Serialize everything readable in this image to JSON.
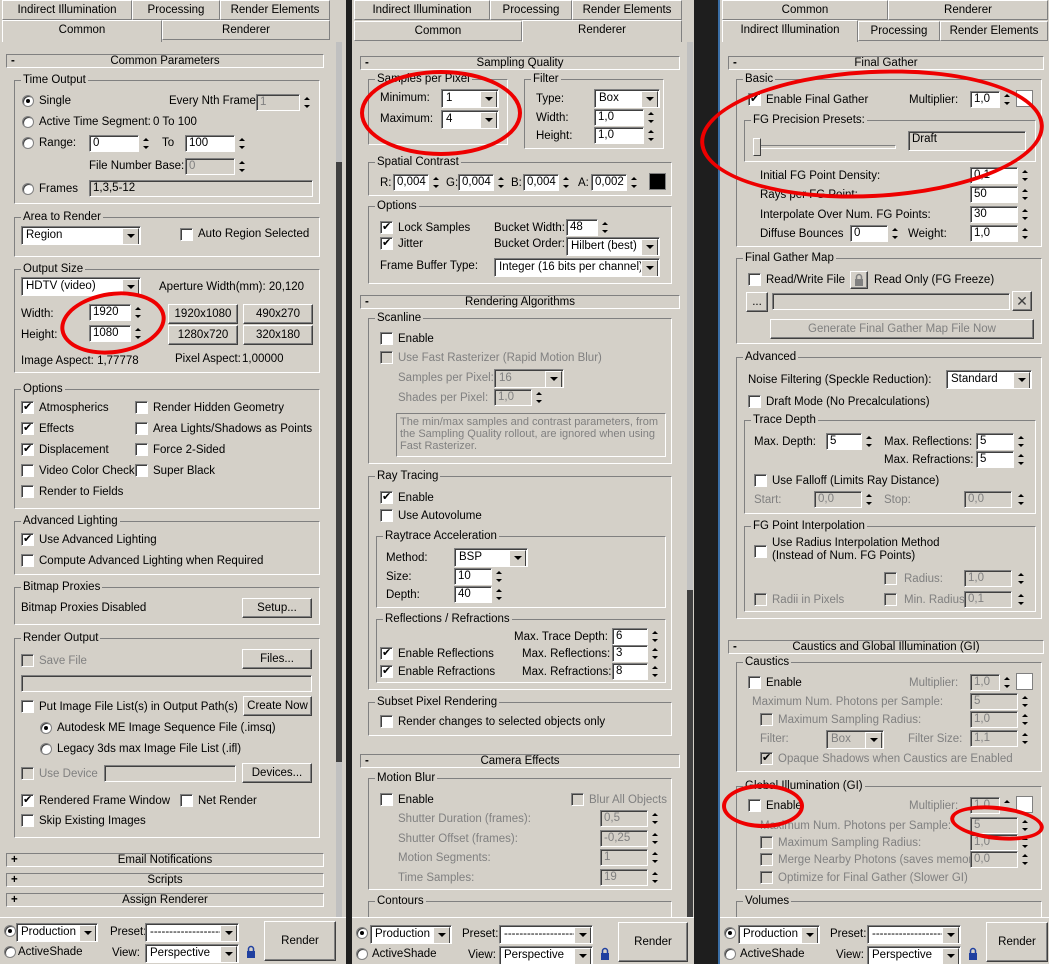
{
  "tabs": {
    "indirect": "Indirect Illumination",
    "processing": "Processing",
    "render_elements": "Render Elements",
    "common": "Common",
    "renderer": "Renderer"
  },
  "common_params": {
    "header": "Common Parameters",
    "time_output": {
      "title": "Time Output",
      "single": "Single",
      "every_nth": "Every Nth Frame:",
      "every_nth_val": "1",
      "active_segment": "Active Time Segment:",
      "segment_range": "0 To 100",
      "range": "Range:",
      "range_from": "0",
      "to": "To",
      "range_to": "100",
      "file_number_base": "File Number Base:",
      "file_number_base_val": "0",
      "frames": "Frames",
      "frames_val": "1,3,5-12"
    },
    "area": {
      "title": "Area to Render",
      "value": "Region",
      "auto_region": "Auto Region Selected"
    },
    "output_size": {
      "title": "Output Size",
      "preset": "HDTV (video)",
      "aperture": "Aperture Width(mm): 20,120",
      "width_label": "Width:",
      "width": "1920",
      "height_label": "Height:",
      "height": "1080",
      "p1": "1920x1080",
      "p2": "490x270",
      "p3": "1280x720",
      "p4": "320x180",
      "image_aspect": "Image Aspect: 1,77778",
      "pixel_aspect": "Pixel Aspect:",
      "pixel_aspect_val": "1,00000"
    },
    "options": {
      "title": "Options",
      "atmospherics": "Atmospherics",
      "render_hidden": "Render Hidden Geometry",
      "effects": "Effects",
      "area_lights": "Area Lights/Shadows as Points",
      "displacement": "Displacement",
      "force2": "Force 2-Sided",
      "video_color": "Video Color Check",
      "super_black": "Super Black",
      "render_fields": "Render to Fields"
    },
    "adv_lighting": {
      "title": "Advanced Lighting",
      "use": "Use Advanced Lighting",
      "compute": "Compute Advanced Lighting when Required"
    },
    "bitmap": {
      "title": "Bitmap Proxies",
      "status": "Bitmap Proxies Disabled",
      "setup": "Setup..."
    },
    "render_output": {
      "title": "Render Output",
      "save_file": "Save File",
      "files": "Files...",
      "put_list": "Put Image File List(s) in Output Path(s)",
      "create_now": "Create Now",
      "autodesk": "Autodesk ME Image Sequence File (.imsq)",
      "legacy": "Legacy 3ds max Image File List (.ifl)",
      "use_device": "Use Device",
      "devices": "Devices...",
      "rfw": "Rendered Frame Window",
      "net_render": "Net Render",
      "skip": "Skip Existing Images"
    },
    "email": "Email Notifications",
    "scripts": "Scripts",
    "assign": "Assign Renderer"
  },
  "sampling": {
    "header": "Sampling Quality",
    "spp_title": "Samples per Pixel",
    "min_label": "Minimum:",
    "min": "1",
    "max_label": "Maximum:",
    "max": "4",
    "filter_title": "Filter",
    "type_label": "Type:",
    "type": "Box",
    "width_label": "Width:",
    "width": "1,0",
    "height_label": "Height:",
    "height": "1,0",
    "spatial_title": "Spatial Contrast",
    "r": "R:",
    "rv": "0,004",
    "g": "G:",
    "gv": "0,004",
    "b": "B:",
    "bv": "0,004",
    "a": "A:",
    "av": "0,002",
    "options_title": "Options",
    "lock": "Lock Samples",
    "bucket_width": "Bucket Width:",
    "bucket_width_val": "48",
    "jitter": "Jitter",
    "bucket_order": "Bucket Order:",
    "bucket_order_val": "Hilbert (best)",
    "fbt": "Frame Buffer Type:",
    "fbt_val": "Integer (16 bits per channel)"
  },
  "algorithms": {
    "header": "Rendering Algorithms",
    "scanline": "Scanline",
    "enable": "Enable",
    "fast_raster": "Use Fast Rasterizer (Rapid Motion Blur)",
    "spp": "Samples per Pixel:",
    "spp_val": "16",
    "sps": "Shades per Pixel:",
    "sps_val": "1,0",
    "note": "The min/max samples and contrast parameters, from the Sampling Quality rollout, are ignored when using Fast Rasterizer.",
    "ray": "Ray Tracing",
    "ray_enable": "Enable",
    "autovolume": "Use Autovolume",
    "accel": "Raytrace Acceleration",
    "method_label": "Method:",
    "method": "BSP",
    "size_label": "Size:",
    "size": "10",
    "depth_label": "Depth:",
    "depth": "40",
    "refl": "Reflections / Refractions",
    "max_trace": "Max. Trace Depth:",
    "max_trace_val": "6",
    "en_refl": "Enable Reflections",
    "max_refl": "Max. Reflections:",
    "max_refl_val": "3",
    "en_refr": "Enable Refractions",
    "max_refr": "Max. Refractions:",
    "max_refr_val": "8",
    "subset": "Subset Pixel Rendering",
    "subset_opt": "Render changes to selected objects only"
  },
  "camera": {
    "header": "Camera Effects",
    "mb": "Motion Blur",
    "enable": "Enable",
    "blur_all": "Blur All Objects",
    "shutter_dur": "Shutter Duration (frames):",
    "shutter_dur_val": "0,5",
    "shutter_off": "Shutter Offset (frames):",
    "shutter_off_val": "-0,25",
    "segments": "Motion Segments:",
    "segments_val": "1",
    "time_samples": "Time Samples:",
    "time_samples_val": "19",
    "contours": "Contours"
  },
  "fg": {
    "header": "Final Gather",
    "basic": "Basic",
    "enable": "Enable Final Gather",
    "multiplier": "Multiplier:",
    "mult_val": "1,0",
    "presets": "FG Precision Presets:",
    "preset_val": "Draft",
    "density": "Initial FG Point Density:",
    "density_val": "0,1",
    "rays": "Rays per FG Point:",
    "rays_val": "50",
    "interp": "Interpolate Over Num. FG Points:",
    "interp_val": "30",
    "diffuse": "Diffuse Bounces",
    "diffuse_val": "0",
    "weight": "Weight:",
    "weight_val": "1,0",
    "map": "Final Gather Map",
    "rw": "Read/Write File",
    "ro": "Read Only (FG Freeze)",
    "browse": "...",
    "generate": "Generate Final Gather Map File Now",
    "adv": "Advanced",
    "noise": "Noise Filtering (Speckle Reduction):",
    "noise_val": "Standard",
    "draft": "Draft Mode (No Precalculations)",
    "trace": "Trace Depth",
    "max_depth": "Max. Depth:",
    "max_depth_val": "5",
    "max_refl": "Max. Reflections:",
    "max_refl_val": "5",
    "max_refr": "Max. Refractions:",
    "max_refr_val": "5",
    "falloff": "Use Falloff (Limits Ray Distance)",
    "start": "Start:",
    "start_val": "0,0",
    "stop": "Stop:",
    "stop_val": "0,0",
    "fgpi": "FG Point Interpolation",
    "radius_interp": "Use Radius Interpolation Method",
    "radius_interp2": "(Instead of Num. FG Points)",
    "radius": "Radius:",
    "radius_val": "1,0",
    "radii_px": "Radii in Pixels",
    "min_radius": "Min. Radius:",
    "min_radius_val": "0,1"
  },
  "caustics": {
    "header": "Caustics and Global Illumination (GI)",
    "caustics": "Caustics",
    "enable": "Enable",
    "multiplier": "Multiplier:",
    "mult_val": "1,0",
    "max_photons": "Maximum Num. Photons per Sample:",
    "max_photons_val": "5",
    "max_radius": "Maximum Sampling Radius:",
    "max_radius_val": "1,0",
    "filter": "Filter:",
    "filter_val": "Box",
    "filter_size": "Filter Size:",
    "filter_size_val": "1,1",
    "opaque": "Opaque Shadows when Caustics are Enabled",
    "gi": "Global Illumination (GI)",
    "gi_enable": "Enable",
    "gi_mult": "Multiplier:",
    "gi_mult_val": "1,0",
    "gi_photons": "Maximum Num. Photons per Sample:",
    "gi_photons_val": "5",
    "gi_radius": "Maximum Sampling Radius:",
    "gi_radius_val": "1,0",
    "merge": "Merge Nearby Photons (saves memory):",
    "merge_val": "0,0",
    "optimize": "Optimize for Final Gather (Slower GI)",
    "volumes": "Volumes"
  },
  "bottom": {
    "production": "Production",
    "activeshade": "ActiveShade",
    "preset": "Preset:",
    "preset_val": "--------------------",
    "view": "View:",
    "view_val": "Perspective",
    "render": "Render"
  }
}
